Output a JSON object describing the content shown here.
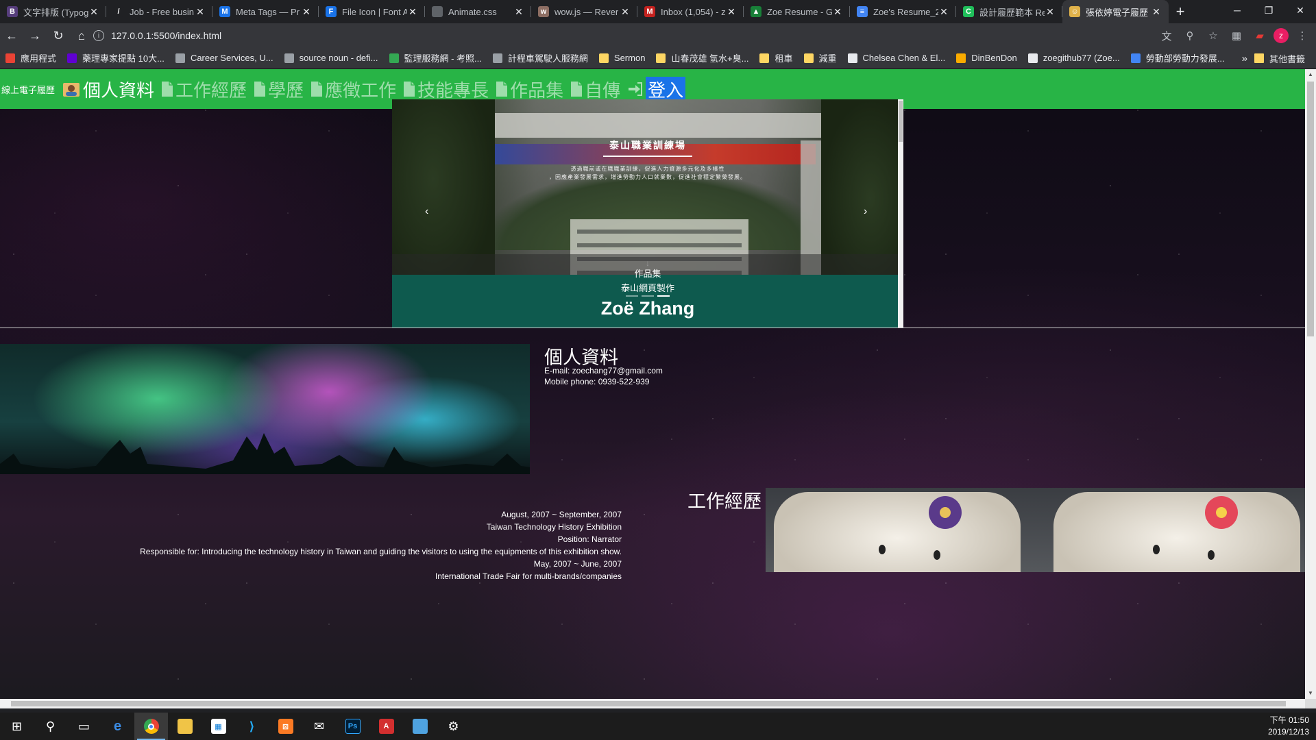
{
  "browser": {
    "tabs": [
      {
        "title": "文字排版 (Typog",
        "fav_text": "B",
        "fav_color": "#563d7c"
      },
      {
        "title": "Job - Free busin",
        "fav_text": "/",
        "fav_color": "#202124"
      },
      {
        "title": "Meta Tags — Pr",
        "fav_text": "M",
        "fav_color": "#1a73e8"
      },
      {
        "title": "File Icon | Font A",
        "fav_text": "F",
        "fav_color": "#1a73e8"
      },
      {
        "title": "Animate.css",
        "fav_text": "",
        "fav_color": "#5f6368"
      },
      {
        "title": "wow.js — Rever",
        "fav_text": "w",
        "fav_color": "#8d6e63"
      },
      {
        "title": "Inbox (1,054) - z",
        "fav_text": "M",
        "fav_color": "#c5221f"
      },
      {
        "title": "Zoe Resume - G",
        "fav_text": "▲",
        "fav_color": "#188038"
      },
      {
        "title": "Zoe's Resume_2",
        "fav_text": "≡",
        "fav_color": "#4285f4"
      },
      {
        "title": "設計履歷範本 Re",
        "fav_text": "C",
        "fav_color": "#1fbf5a"
      },
      {
        "title": "張依婷電子履歷",
        "fav_text": "☺",
        "fav_color": "#e0b24a"
      }
    ],
    "address": "127.0.0.1:5500/index.html",
    "bookmarks": [
      {
        "label": "應用程式",
        "color": "#ea4335"
      },
      {
        "label": "藥理專家提點 10大...",
        "color": "#6001d2"
      },
      {
        "label": "Career Services, U...",
        "color": "#9aa0a6"
      },
      {
        "label": "source noun - defi...",
        "color": "#9aa0a6"
      },
      {
        "label": "監理服務網 - 考照...",
        "color": "#34a853"
      },
      {
        "label": "計程車駕駛人服務網",
        "color": "#9aa0a6"
      },
      {
        "label": "Sermon",
        "color": "#fdd663"
      },
      {
        "label": "山春茂雄 氫水+臭...",
        "color": "#fdd663"
      },
      {
        "label": "租車",
        "color": "#fdd663"
      },
      {
        "label": "減重",
        "color": "#fdd663"
      },
      {
        "label": "Chelsea Chen & El...",
        "color": "#e8eaed"
      },
      {
        "label": "DinBenDon",
        "color": "#f9ab00"
      },
      {
        "label": "zoegithub77 (Zoe...",
        "color": "#e8eaed"
      },
      {
        "label": "勞動部勞動力發展...",
        "color": "#4285f4"
      }
    ],
    "bookmarks_more": "»",
    "other_bookmarks": "其他書籤",
    "avatar_letter": "z"
  },
  "nav": {
    "brand": "線上電子履歷",
    "home": "個人資料",
    "items": [
      "工作經歷",
      "學歷",
      "應徵工作",
      "技能專長",
      "作品集",
      "自傳"
    ],
    "login": "登入"
  },
  "carousel": {
    "slide_title": "泰山職業訓練場",
    "slide_sub_1": "透過職前或在職職業訓練，促進人力資源多元化及多樣性",
    "slide_sub_2": "，因應產業發展需求，增進勞動力人口就業數，促進社會穩定繁榮發展。",
    "caption_title": "作品集",
    "caption_sub": "泰山網頁製作",
    "prev": "‹",
    "next": "›",
    "scroll_hint": "↓",
    "indicators": 3,
    "active_index": 2
  },
  "profile": {
    "name": "Zoë Zhang",
    "personal_title": "個人資料",
    "email": "E-mail: zoechang77@gmail.com",
    "phone": "Mobile phone: 0939-522-939",
    "work_title": "工作經歷",
    "work_lines": [
      "August, 2007 ~ September, 2007",
      "Taiwan Technology History Exhibition",
      "Position: Narrator",
      "Responsible for: Introducing the technology history in Taiwan and guiding the visitors to using the equipments of this exhibition show.",
      "May, 2007 ~ June, 2007",
      "International Trade Fair for multi-brands/companies"
    ]
  },
  "taskbar": {
    "time": "下午 01:50",
    "date": "2019/12/13"
  }
}
